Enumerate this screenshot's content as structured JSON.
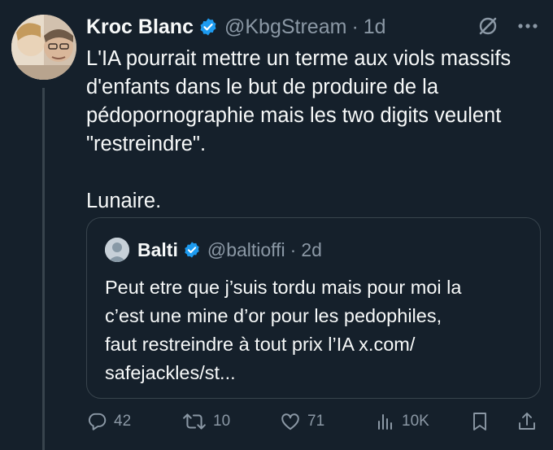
{
  "tweet": {
    "author_name": "Kroc Blanc",
    "handle": "@KbgStream",
    "separator": "·",
    "time": "1d",
    "paragraphs": [
      "L'IA pourrait mettre un terme aux viols massifs\nd'enfants dans le but de produire de la\npédopornographie mais les two digits veulent\n\"restreindre\".",
      "Lunaire."
    ]
  },
  "quote": {
    "author_name": "Balti",
    "handle": "@baltioffi",
    "separator": "·",
    "time": "2d",
    "text": "Peut etre que j’suis tordu mais pour moi la\nc’est une mine d’or pour les pedophiles,\nfaut restreindre à tout prix l’IA x.com/\nsafejackles/st..."
  },
  "actions": {
    "replies": "42",
    "retweets": "10",
    "likes": "71",
    "views": "10K"
  },
  "colors": {
    "background": "#15202b",
    "text": "#f7f9f9",
    "muted": "#8b98a5",
    "border": "#38444d",
    "verified": "#1d9bf0"
  },
  "icons": [
    "verified-badge-icon",
    "grok-icon",
    "more-icon",
    "reply-icon",
    "retweet-icon",
    "like-icon",
    "views-icon",
    "bookmark-icon",
    "share-icon"
  ]
}
